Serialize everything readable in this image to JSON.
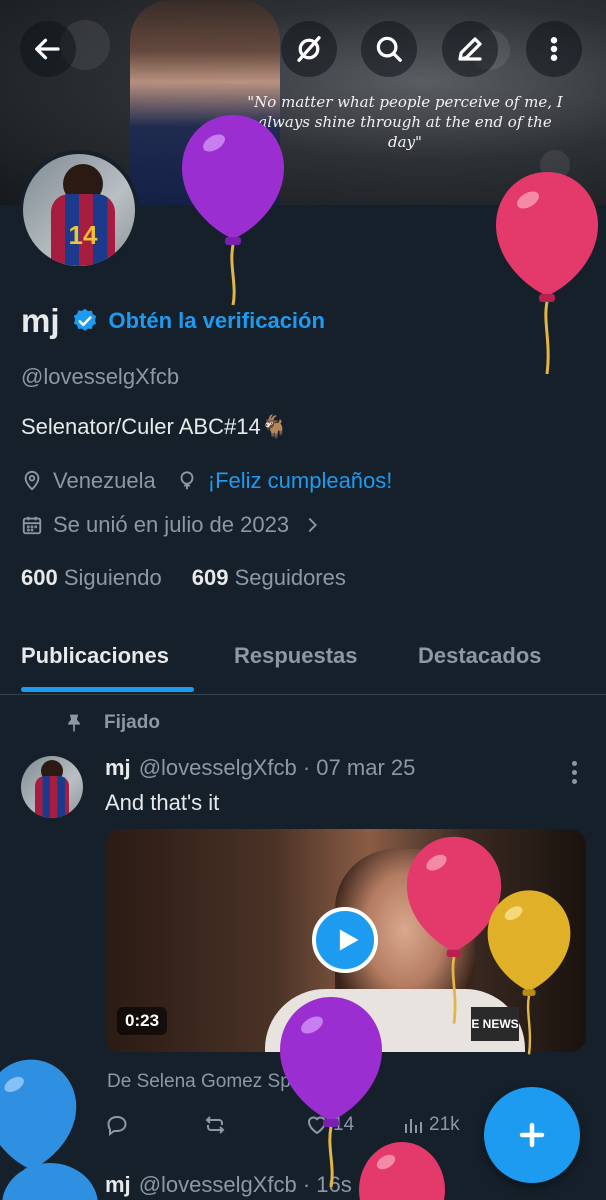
{
  "colors": {
    "background": "#15202b",
    "accent": "#1d9bf0",
    "text_primary": "#e7e9ea",
    "text_secondary": "#8b98a5",
    "divider": "#38444d"
  },
  "banner": {
    "quote": "\"No matter what people perceive of me, I always shine through at the end of the day\""
  },
  "toolbar": {
    "back_icon": "arrow-left-icon",
    "grok_icon": "grok-icon",
    "search_icon": "search-icon",
    "edit_icon": "pencil-icon",
    "more_icon": "more-vertical-icon"
  },
  "profile": {
    "name": "mj",
    "verify_link": "Obtén la verificación",
    "handle": "@lovesselgXfcb",
    "bio": "Selenator/Culer  ABC#14🐐",
    "location": "Venezuela",
    "birthday": "¡Feliz cumpleaños!",
    "joined": "Se unió en julio de 2023",
    "following_count": "600",
    "following_label": "Siguiendo",
    "followers_count": "609",
    "followers_label": "Seguidores",
    "avatar_number": "14"
  },
  "tabs": [
    {
      "label": "Publicaciones",
      "active": true
    },
    {
      "label": "Respuestas",
      "active": false
    },
    {
      "label": "Destacados",
      "active": false
    }
  ],
  "pinned_post": {
    "pinned_label": "Fijado",
    "author_name": "mj",
    "meta": "@lovesselgXfcb · 07 mar 25",
    "text": "And that's it",
    "video_duration": "0:23",
    "video_watermark": "E NEWS",
    "source": "De Selena Gomez Spain",
    "replies": "",
    "reposts": "",
    "likes": "14",
    "views": "21k"
  },
  "next_post": {
    "author_name": "mj",
    "meta": "@lovesselgXfcb · 16s"
  }
}
